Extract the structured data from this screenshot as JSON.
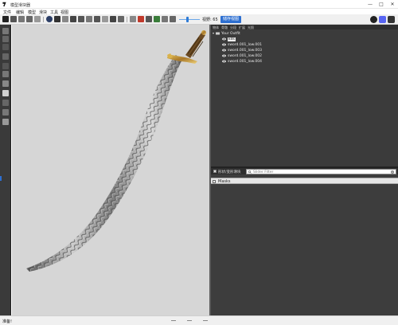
{
  "window": {
    "title": "模型滑块器",
    "min_glyph": "—",
    "max_glyph": "□",
    "close_glyph": "✕"
  },
  "menu": [
    "文件",
    "编辑",
    "模型",
    "滑块",
    "工具",
    "视图"
  ],
  "toolbar": {
    "fov_label": "视野: 65",
    "frame_button": "储存视图"
  },
  "scene": {
    "tabs": [
      "物体",
      "骨骼",
      "分段",
      "扩展",
      "光照"
    ],
    "root_label": "Your Outfit",
    "items": [
      "kds",
      "sword.001_low.001",
      "sword.001_low.003",
      "sword.001_low.002",
      "sword.001_low.004"
    ]
  },
  "shapes": {
    "title": "形状/变形滑块",
    "filter_placeholder": "Slider Filter",
    "clear_glyph": "×",
    "masks_label": "Masks"
  },
  "status": {
    "text": "准备!"
  },
  "colors": {
    "accent": "#2d6fd1",
    "panel_dark": "#3b3b3b",
    "viewport_bg": "#d6d6d6"
  }
}
